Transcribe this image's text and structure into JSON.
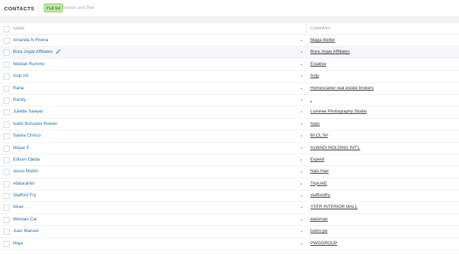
{
  "header": {
    "title": "CONTACTS",
    "filter_chip": "Full list",
    "search_placeholder": "Search and filter"
  },
  "table": {
    "columns": {
      "name": "NAME",
      "company": "COMPANY"
    },
    "rows": [
      {
        "name": "Amanda N Rivera",
        "company": "Maga Atelier"
      },
      {
        "name": "Bora Jogar Affiliates",
        "company": "Bora Jogar Affiliates",
        "hovered": true
      },
      {
        "name": "Median Rummo",
        "company": "Estative"
      },
      {
        "name": "Aslp AS",
        "company": "Aslp"
      },
      {
        "name": "Rana",
        "company": "Homescaner real estate brokers"
      },
      {
        "name": "Randy",
        "company": ","
      },
      {
        "name": "Juliette Sawyer",
        "company": "Lumiree Photography Studio"
      },
      {
        "name": "Ivaiiü Burucker Bowen",
        "company": "Ivaiu"
      },
      {
        "name": "Sasha Chirico",
        "company": "BI.CL Srl"
      },
      {
        "name": "Mayar E",
        "company": "ALWADI HOLDING INT'L"
      },
      {
        "name": "Edison Ojeda",
        "company": "Expertl"
      },
      {
        "name": "Jesus Martin",
        "company": "Nais Hair"
      },
      {
        "name": "Abdurahim",
        "company": "TripUAE"
      },
      {
        "name": "Stafford Fry",
        "company": "staffordfry"
      },
      {
        "name": "Nirav",
        "company": "YTER INTERIOR MALL"
      },
      {
        "name": "Weixian Cai",
        "company": "weixman"
      },
      {
        "name": "Juan Manuel",
        "company": "lustro.pe"
      },
      {
        "name": "Maja",
        "company": "PWGGROUP"
      }
    ]
  }
}
